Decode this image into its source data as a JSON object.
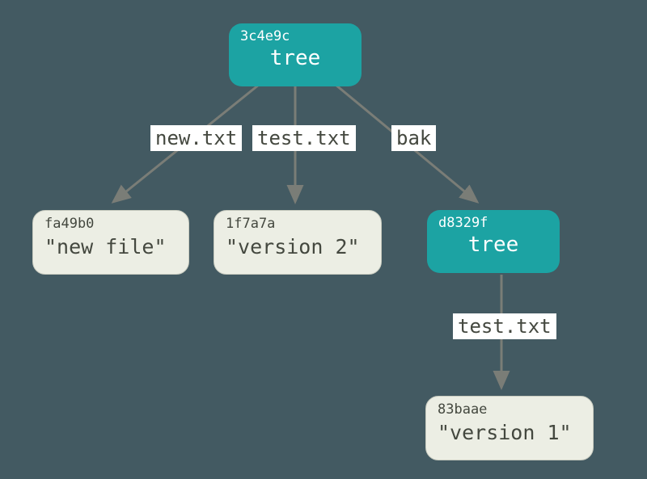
{
  "colors": {
    "bg": "#435a62",
    "tree": "#1ca3a3",
    "blob": "#eceee4",
    "arrow": "#7a7d77",
    "label_bg": "#ffffff"
  },
  "nodes": {
    "root": {
      "kind": "tree",
      "hash": "3c4e9c",
      "type_label": "tree"
    },
    "new_file": {
      "kind": "blob",
      "hash": "fa49b0",
      "content": "\"new file\""
    },
    "version2": {
      "kind": "blob",
      "hash": "1f7a7a",
      "content": "\"version 2\""
    },
    "subtree": {
      "kind": "tree",
      "hash": "d8329f",
      "type_label": "tree"
    },
    "version1": {
      "kind": "blob",
      "hash": "83baae",
      "content": "\"version 1\""
    }
  },
  "edges": {
    "root_new_txt": {
      "label": "new.txt"
    },
    "root_test_txt": {
      "label": "test.txt"
    },
    "root_bak": {
      "label": "bak"
    },
    "sub_test_txt": {
      "label": "test.txt"
    }
  }
}
